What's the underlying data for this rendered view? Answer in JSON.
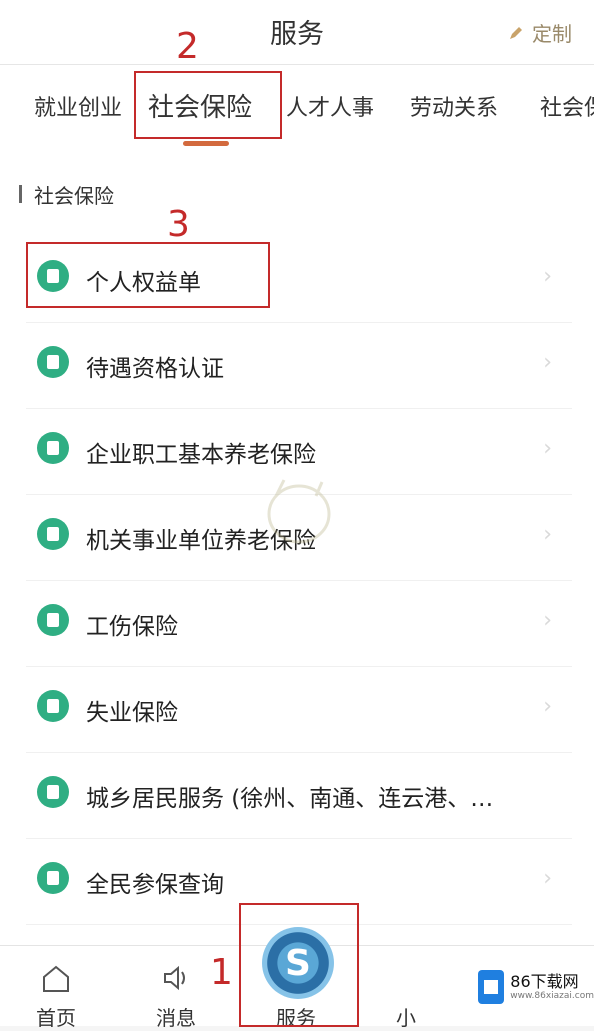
{
  "header": {
    "title": "服务",
    "custom_label": "定制"
  },
  "tabs": [
    "就业创业",
    "社会保险",
    "人才人事",
    "劳动关系",
    "社会保"
  ],
  "section_title": "社会保险",
  "items": [
    "个人权益单",
    "待遇资格认证",
    "企业职工基本养老保险",
    "机关事业单位养老保险",
    "工伤保险",
    "失业保险",
    "城乡居民服务 (徐州、南通、连云港、…",
    "全民参保查询"
  ],
  "annotations": {
    "n1": "1",
    "n2": "2",
    "n3": "3"
  },
  "bottom_nav": {
    "home": "首页",
    "messages": "消息",
    "service": "服务",
    "mine": "小"
  },
  "brand": {
    "name": "86下载网",
    "sub": "www.86xiazai.com"
  },
  "colors": {
    "accent": "#d36a3e",
    "icon_green": "#2fae83",
    "annotation_red": "#c42a2a"
  }
}
